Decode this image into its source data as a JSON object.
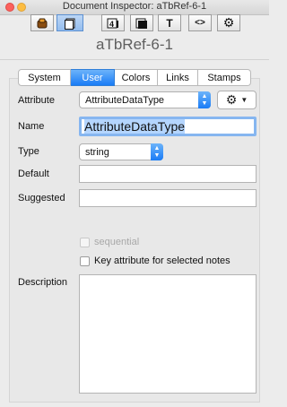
{
  "window": {
    "title": "Document Inspector: aTbRef-6-1"
  },
  "toolbar": {
    "buttons": [
      {
        "name": "general",
        "glyph": ""
      },
      {
        "name": "text",
        "glyph": ""
      },
      {
        "name": "quickstamp",
        "glyph": "4"
      },
      {
        "name": "appearance",
        "glyph": ""
      },
      {
        "name": "t-label",
        "glyph": "T"
      },
      {
        "name": "action",
        "glyph": "<>"
      },
      {
        "name": "settings",
        "glyph": "⚙"
      }
    ],
    "selected_index": 1
  },
  "note": {
    "title": "aTbRef-6-1"
  },
  "tabs": {
    "items": [
      "System",
      "User",
      "Colors",
      "Links",
      "Stamps"
    ],
    "selected": "User"
  },
  "form": {
    "attribute_label": "Attribute",
    "attribute_value": "AttributeDataType",
    "name_label": "Name",
    "name_value": "AttributeDataType",
    "type_label": "Type",
    "type_value": "string",
    "default_label": "Default",
    "default_value": "",
    "suggested_label": "Suggested",
    "suggested_value": "",
    "sequential_label": "sequential",
    "sequential_checked": false,
    "key_attr_label": "Key attribute for selected notes",
    "key_attr_checked": false,
    "description_label": "Description",
    "description_value": ""
  },
  "colors": {
    "accent": "#1a7cf6",
    "focus_ring": "#86b6f0",
    "selection": "#b4d5fe"
  }
}
